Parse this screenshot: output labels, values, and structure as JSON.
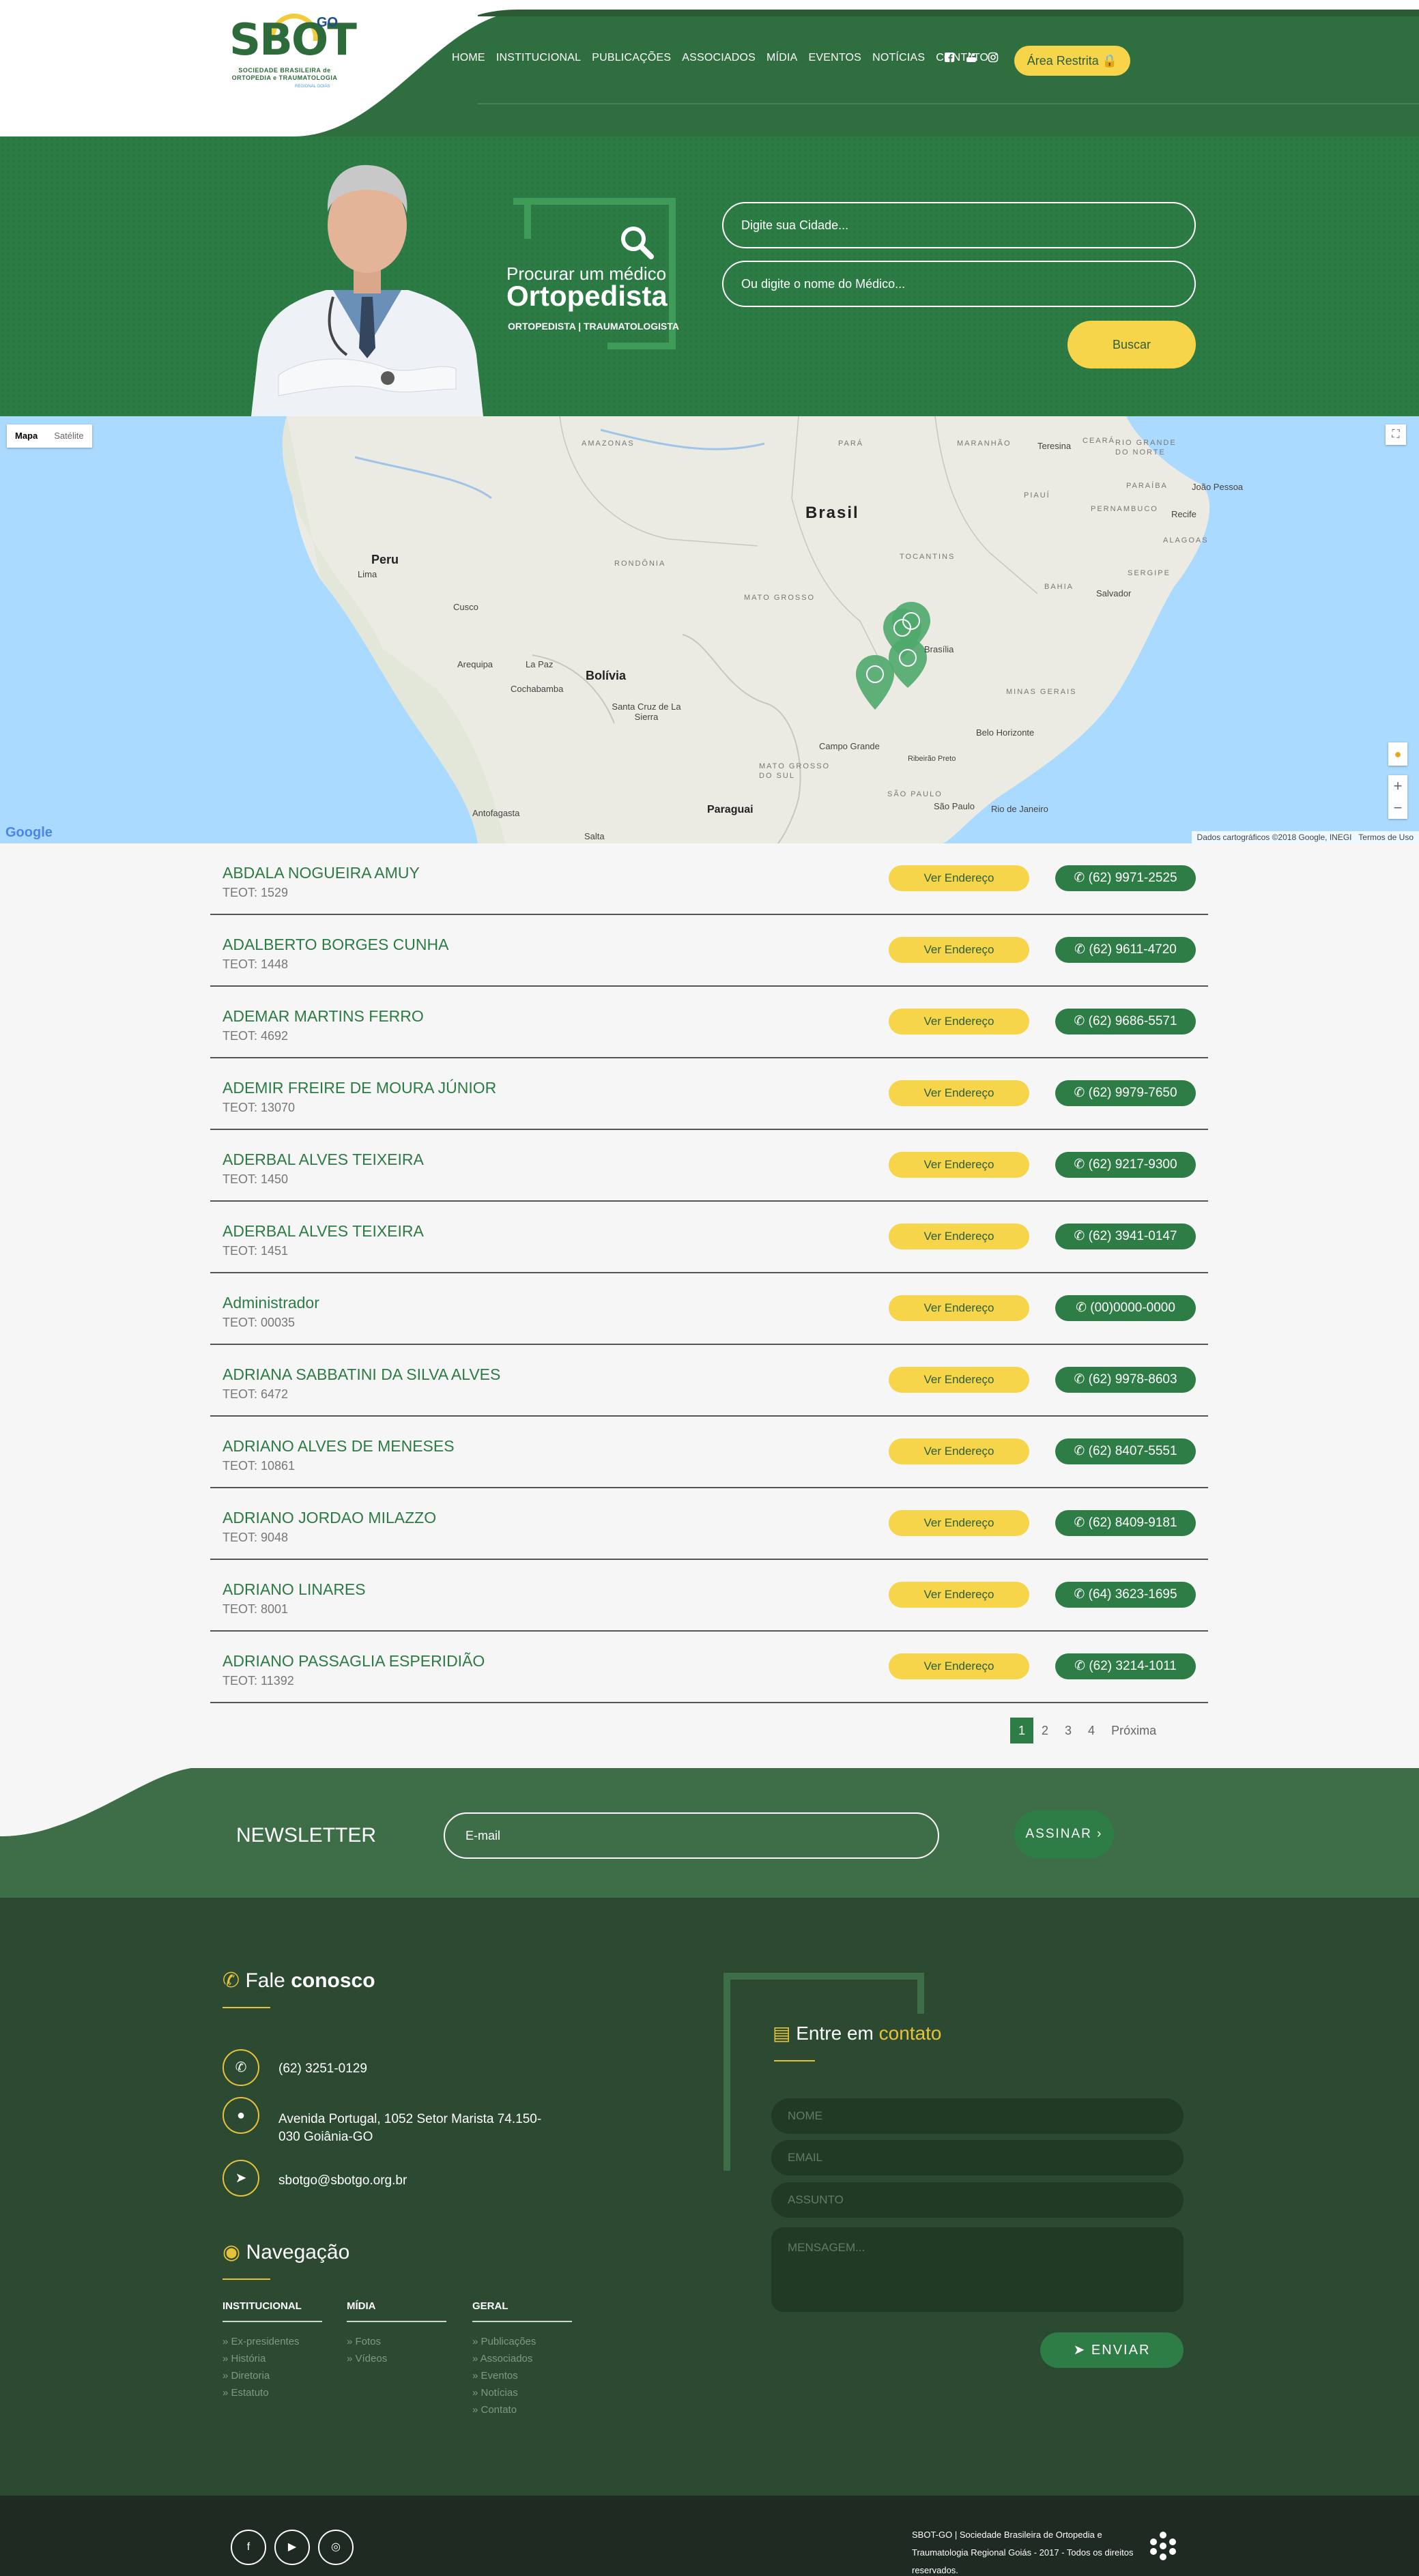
{
  "header": {
    "logo": {
      "main": "SBOT",
      "go": "GO",
      "subtitle": "SOCIEDADE BRASILEIRA de ORTOPEDIA e TRAUMATOLOGIA",
      "regional": "REGIONAL GOIÁS"
    },
    "nav": [
      "HOME",
      "INSTITUCIONAL",
      "PUBLICAÇÕES",
      "ASSOCIADOS",
      "MÍDIA",
      "EVENTOS",
      "NOTÍCIAS",
      "CONTATO"
    ],
    "social_icons": [
      "facebook-icon",
      "youtube-icon",
      "instagram-icon"
    ],
    "restricted_label": "Área Restrita"
  },
  "hero": {
    "title_line1": "Procurar um médico",
    "title_line2": "Ortopedista",
    "subtitle": "ORTOPEDISTA | TRAUMATOLOGISTA",
    "city_placeholder": "Digite sua Cidade...",
    "doctor_placeholder": "Ou digite o nome do Médico...",
    "search_label": "Buscar"
  },
  "map": {
    "type_options": [
      "Mapa",
      "Satélite"
    ],
    "labels": {
      "brasil": "Brasil",
      "peru": "Peru",
      "bolivia": "Bolívia",
      "paraguai": "Paraguai",
      "lima": "Lima",
      "cusco": "Cusco",
      "arequipa": "Arequipa",
      "lapaz": "La Paz",
      "cochabamba": "Cochabamba",
      "santacruz": "Santa Cruz de La Sierra",
      "antofagasta": "Antofagasta",
      "salta": "Salta",
      "amazonas": "AMAZONAS",
      "para": "PARÁ",
      "maranhao": "MARANHÃO",
      "ceara": "CEARÁ",
      "piaui": "PIAUÍ",
      "rgn": "RIO GRANDE DO NORTE",
      "paraiba": "PARAÍBA",
      "pernambuco": "PERNAMBUCO",
      "alagoas": "ALAGOAS",
      "sergipe": "SERGIPE",
      "bahia": "BAHIA",
      "tocantins": "TOCANTINS",
      "rondonia": "RONDÔNIA",
      "matogrosso": "MATO GROSSO",
      "msul": "MATO GROSSO DO SUL",
      "saopaulo_st": "SÃO PAULO",
      "minas": "MINAS GERAIS",
      "teresina": "Teresina",
      "joaopessoa": "João Pessoa",
      "recife": "Recife",
      "salvador": "Salvador",
      "brasilia": "Brasília",
      "belohorizonte": "Belo Horizonte",
      "riberiaopreto": "Ribeirão Preto",
      "saopaulo": "São Paulo",
      "riodejaneiro": "Rio de Janeiro",
      "campogrande": "Campo Grande"
    },
    "attribution": "Dados cartográficos ©2018 Google, INEGI",
    "terms": "Termos de Uso",
    "google": "Google"
  },
  "doctors": [
    {
      "name": "ABDALA NOGUEIRA AMUY",
      "teot": "TEOT: 1529",
      "phone": "(62) 9971-2525"
    },
    {
      "name": "ADALBERTO BORGES CUNHA",
      "teot": "TEOT: 1448",
      "phone": "(62) 9611-4720"
    },
    {
      "name": "ADEMAR MARTINS FERRO",
      "teot": "TEOT: 4692",
      "phone": "(62) 9686-5571"
    },
    {
      "name": "ADEMIR FREIRE DE MOURA JÚNIOR",
      "teot": "TEOT: 13070",
      "phone": "(62) 9979-7650"
    },
    {
      "name": "ADERBAL ALVES TEIXEIRA",
      "teot": "TEOT: 1450",
      "phone": "(62) 9217-9300"
    },
    {
      "name": "ADERBAL ALVES TEIXEIRA",
      "teot": "TEOT: 1451",
      "phone": "(62) 3941-0147"
    },
    {
      "name": "Administrador",
      "teot": "TEOT: 00035",
      "phone": "(00)0000-0000"
    },
    {
      "name": "ADRIANA SABBATINI DA SILVA ALVES",
      "teot": "TEOT: 6472",
      "phone": "(62) 9978-8603"
    },
    {
      "name": "ADRIANO ALVES DE MENESES",
      "teot": "TEOT: 10861",
      "phone": "(62) 8407-5551"
    },
    {
      "name": "ADRIANO JORDAO MILAZZO",
      "teot": "TEOT: 9048",
      "phone": "(62) 8409-9181"
    },
    {
      "name": "ADRIANO LINARES",
      "teot": "TEOT: 8001",
      "phone": "(64) 3623-1695"
    },
    {
      "name": "ADRIANO PASSAGLIA ESPERIDIÃO",
      "teot": "TEOT: 11392",
      "phone": "(62) 3214-1011"
    }
  ],
  "address_label": "Ver Endereço",
  "pagination": {
    "pages": [
      "1",
      "2",
      "3",
      "4"
    ],
    "next": "Próxima",
    "current": "1"
  },
  "newsletter": {
    "title": "NEWSLETTER",
    "placeholder": "E-mail",
    "button": "ASSINAR"
  },
  "footer": {
    "contact_title_a": "Fale ",
    "contact_title_b": "conosco",
    "phone": "(62) 3251-0129",
    "address": "Avenida Portugal, 1052 Setor Marista 74.150-030 Goiânia-GO",
    "email": "sbotgo@sbotgo.org.br",
    "nav_title": "Navegação",
    "columns": [
      {
        "title": "INSTITUCIONAL",
        "items": [
          "» Ex-presidentes",
          "» História",
          "» Diretoria",
          "» Estatuto"
        ]
      },
      {
        "title": "MÍDIA",
        "items": [
          "» Fotos",
          "» Vídeos"
        ]
      },
      {
        "title": "GERAL",
        "items": [
          "» Publicações",
          "» Associados",
          "» Eventos",
          "» Notícias",
          "» Contato"
        ]
      }
    ],
    "form_title_a": "Entre em ",
    "form_title_b": "contato",
    "form": {
      "name": "NOME",
      "email": "EMAIL",
      "subject": "ASSUNTO",
      "message": "MENSAGEM...",
      "send": "ENVIAR"
    }
  },
  "bottom": {
    "copyright": "SBOT-GO | Sociedade Brasileira de Ortopedia e Traumatologia Regional Goiás - 2017 - Todos os direitos reservados.",
    "social_icons": [
      "facebook-icon",
      "youtube-icon",
      "instagram-icon"
    ]
  },
  "colors": {
    "green": "#2c7a44",
    "dark_green": "#2c4a32",
    "yellow": "#f7d54b",
    "newsletter": "#3d6e47"
  }
}
